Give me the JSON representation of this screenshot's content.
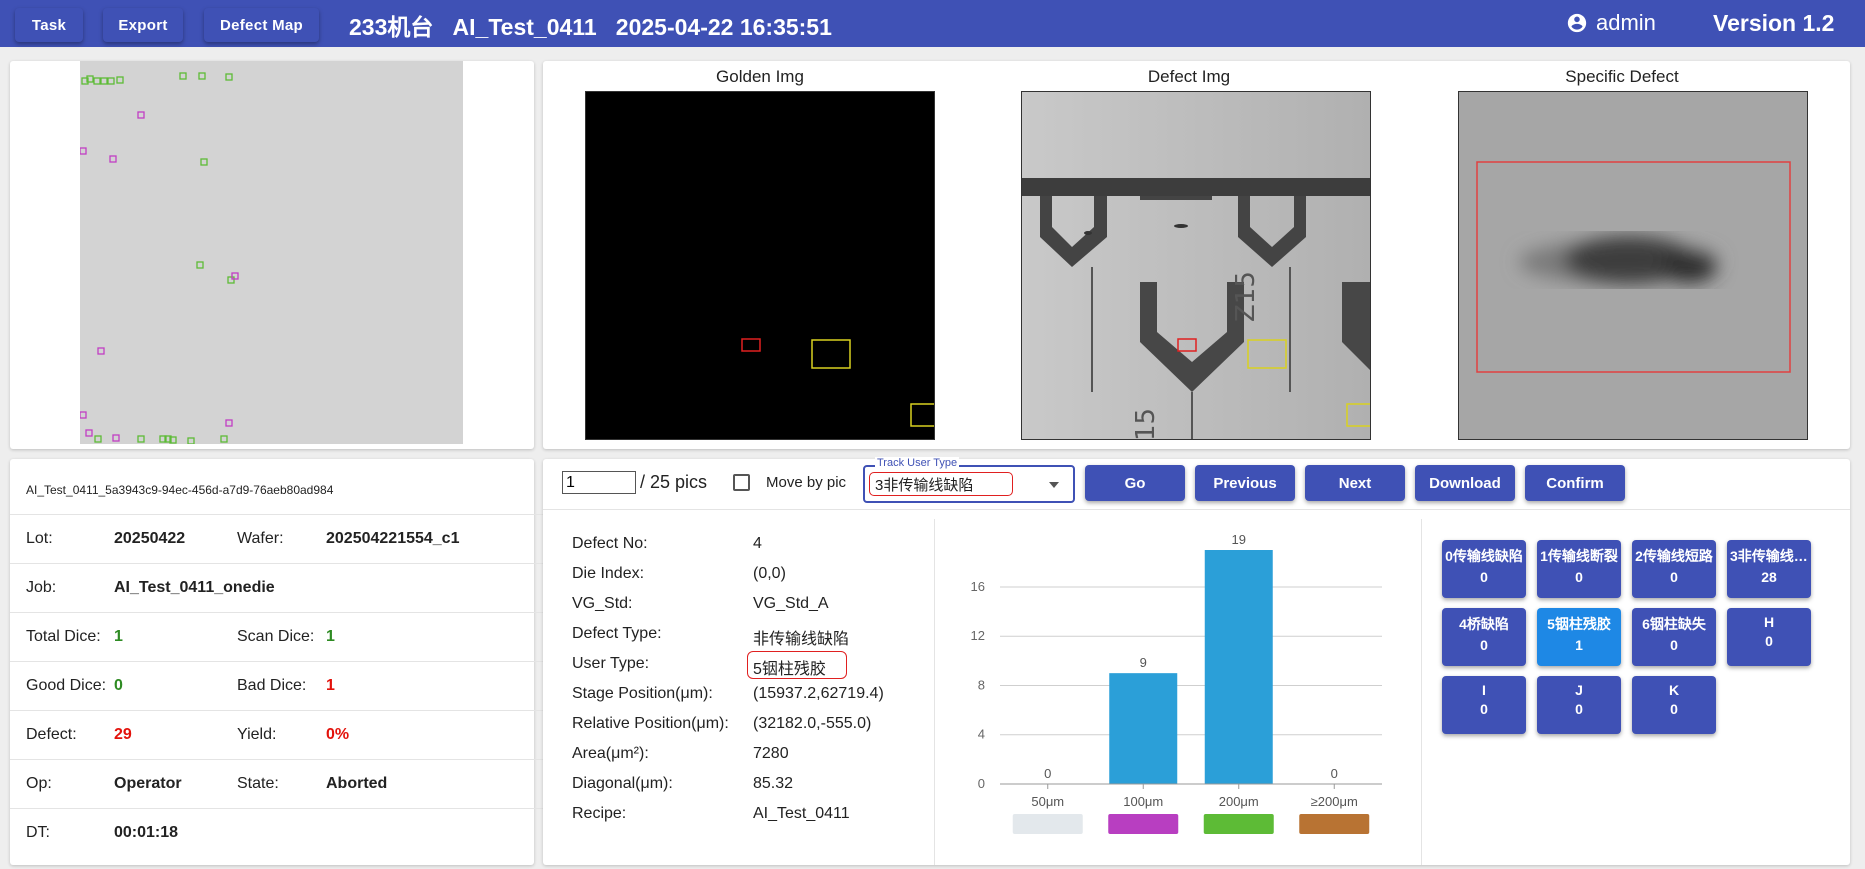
{
  "toolbar": {
    "task": "Task",
    "export": "Export",
    "defect_map": "Defect Map"
  },
  "header": {
    "title": "233机台   AI_Test_0411   2025-04-22 16:35:51",
    "user": "admin",
    "version": "Version 1.2"
  },
  "images": {
    "golden": "Golden Img",
    "defect": "Defect Img",
    "specific": "Specific Defect"
  },
  "wafer_id": "AI_Test_0411_5a3943c9-94ec-456d-a7d9-76aeb80ad984",
  "summary": {
    "lot_label": "Lot:",
    "lot": "20250422",
    "wafer_label": "Wafer:",
    "wafer": "202504221554_c1",
    "job_label": "Job:",
    "job": "AI_Test_0411_onedie",
    "total_label": "Total Dice:",
    "total": "1",
    "scan_label": "Scan Dice:",
    "scan": "1",
    "good_label": "Good Dice:",
    "good": "0",
    "bad_label": "Bad Dice:",
    "bad": "1",
    "defect_label": "Defect:",
    "defect": "29",
    "yield_label": "Yield:",
    "yield": "0%",
    "op_label": "Op:",
    "op": "Operator",
    "state_label": "State:",
    "state": "Aborted",
    "dt_label": "DT:",
    "dt": "00:01:18"
  },
  "nav": {
    "page_value": "1",
    "page_total": "/ 25 pics",
    "move_by_pic": "Move by pic",
    "track_label": "Track User Type",
    "track_value": "3非传输线缺陷",
    "go": "Go",
    "previous": "Previous",
    "next": "Next",
    "download": "Download",
    "confirm": "Confirm"
  },
  "detail": [
    {
      "label": "Defect No:",
      "value": "4"
    },
    {
      "label": "Die Index:",
      "value": "(0,0)"
    },
    {
      "label": "VG_Std:",
      "value": "VG_Std_A"
    },
    {
      "label": "Defect Type:",
      "value": "非传输线缺陷"
    },
    {
      "label": "User Type:",
      "value": "5铟柱残胶"
    },
    {
      "label": "Stage Position(μm):",
      "value": "(15937.2,62719.4)"
    },
    {
      "label": "Relative Position(μm):",
      "value": "(32182.0,-555.0)"
    },
    {
      "label": "Area(μm²):",
      "value": "7280"
    },
    {
      "label": "Diagonal(μm):",
      "value": "85.32"
    },
    {
      "label": "Recipe:",
      "value": "AI_Test_0411"
    }
  ],
  "chart_data": {
    "type": "bar",
    "categories": [
      "50μm",
      "100μm",
      "200μm",
      "≥200μm"
    ],
    "values": [
      0,
      9,
      19,
      0
    ],
    "ylim": [
      0,
      19
    ],
    "yticks": [
      0,
      4,
      8,
      12,
      16
    ],
    "bar_color": "#2b9fd8",
    "legend_colors": [
      "#e3e8ec",
      "#b83ec1",
      "#5dbb36",
      "#b87333"
    ]
  },
  "user_types": [
    {
      "name": "0传输线缺陷",
      "count": "0"
    },
    {
      "name": "1传输线断裂",
      "count": "0"
    },
    {
      "name": "2传输线短路",
      "count": "0"
    },
    {
      "name": "3非传输线缺陷",
      "count": "28"
    },
    {
      "name": "4桥缺陷",
      "count": "0"
    },
    {
      "name": "5铟柱残胶",
      "count": "1",
      "active": true
    },
    {
      "name": "6铟柱缺失",
      "count": "0"
    },
    {
      "name": "H",
      "count": "0"
    },
    {
      "name": "I",
      "count": "0"
    },
    {
      "name": "J",
      "count": "0"
    },
    {
      "name": "K",
      "count": "0"
    }
  ],
  "icons": {
    "user": "account-circle-icon",
    "dropdown": "arrow-drop-down-icon"
  },
  "colors": {
    "primary": "#3f51b5",
    "active": "#1e88e5",
    "green": "#2e8b23",
    "red": "#e3120b"
  }
}
